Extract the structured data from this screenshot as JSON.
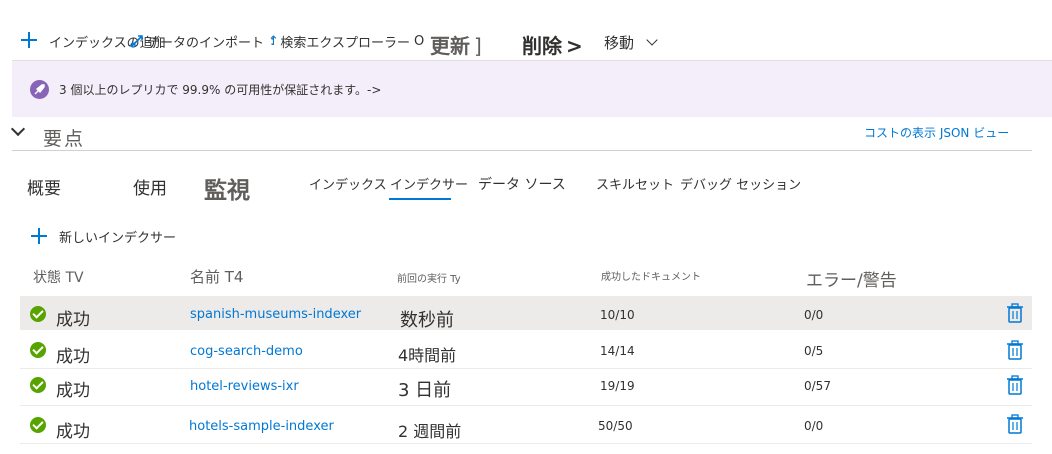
{
  "toolbar": {
    "add_index": "インデックスの追加",
    "import_data": "データのインポート",
    "search_explorer": "検索エクスプローラー",
    "refresh": "更新",
    "delete": "削除",
    "move": "移動"
  },
  "banner": {
    "message": "3 個以上のレプリカで 99.9% の可用性が保証されます。->"
  },
  "essentials": {
    "title": "要点",
    "links": "コストの表示 JSON ビュー"
  },
  "tabs": {
    "overview": "概要",
    "usage": "使用",
    "monitoring": "監視",
    "indexes": "インデックス",
    "indexers": "インデクサー",
    "data_sources": "データ ソース",
    "skillsets": "スキルセット",
    "debug_sessions": "デバッグ セッション"
  },
  "new_indexer": "新しいインデクサー",
  "table": {
    "headers": {
      "status": "状態 TV",
      "name": "名前 T4",
      "last_run": "前回の実行 Ty",
      "docs": "成功したドキュメント",
      "errors": "エラー/警告"
    },
    "rows": [
      {
        "status": "成功",
        "name": "spanish-museums-indexer",
        "last_run": "数秒前",
        "docs": "10/10",
        "errors": "0/0"
      },
      {
        "status": "成功",
        "name": "cog-search-demo",
        "last_run": "4時間前",
        "docs": "14/14",
        "errors": "0/5"
      },
      {
        "status": "成功",
        "name": "hotel-reviews-ixr",
        "last_run": "3 日前",
        "docs": "19/19",
        "errors": "0/57"
      },
      {
        "status": "成功",
        "name": "hotels-sample-indexer",
        "last_run": "2 週間前",
        "docs": "50/50",
        "errors": "0/0"
      }
    ]
  },
  "colors": {
    "accent": "#0078d4",
    "success": "#57a300",
    "banner_bg": "#f4eefa",
    "selected_row": "#edebe9"
  }
}
